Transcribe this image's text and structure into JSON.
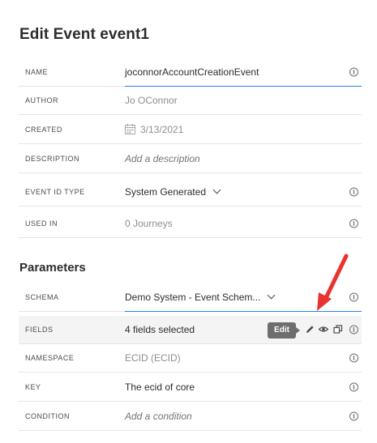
{
  "header": {
    "title": "Edit Event event1"
  },
  "properties": {
    "name": {
      "label": "NAME",
      "value": "joconnorAccountCreationEvent"
    },
    "author": {
      "label": "AUTHOR",
      "value": "Jo OConnor"
    },
    "created": {
      "label": "CREATED",
      "value": "3/13/2021"
    },
    "description": {
      "label": "DESCRIPTION",
      "placeholder": "Add a description"
    },
    "event_id_type": {
      "label": "EVENT ID TYPE",
      "value": "System Generated"
    },
    "used_in": {
      "label": "USED IN",
      "value": "0 Journeys"
    }
  },
  "parameters": {
    "title": "Parameters",
    "schema": {
      "label": "SCHEMA",
      "value": "Demo System - Event Schem..."
    },
    "fields": {
      "label": "FIELDS",
      "value": "4 fields selected",
      "tooltip": "Edit"
    },
    "namespace": {
      "label": "NAMESPACE",
      "value": "ECID (ECID)"
    },
    "key": {
      "label": "KEY",
      "value": "The ecid of core"
    },
    "condition": {
      "label": "CONDITION",
      "placeholder": "Add a condition"
    }
  },
  "info_glyph": "i",
  "colors": {
    "accent_underline": "#2680eb",
    "annotation_arrow": "#e8332f",
    "tooltip_bg": "#6e6e6e"
  }
}
